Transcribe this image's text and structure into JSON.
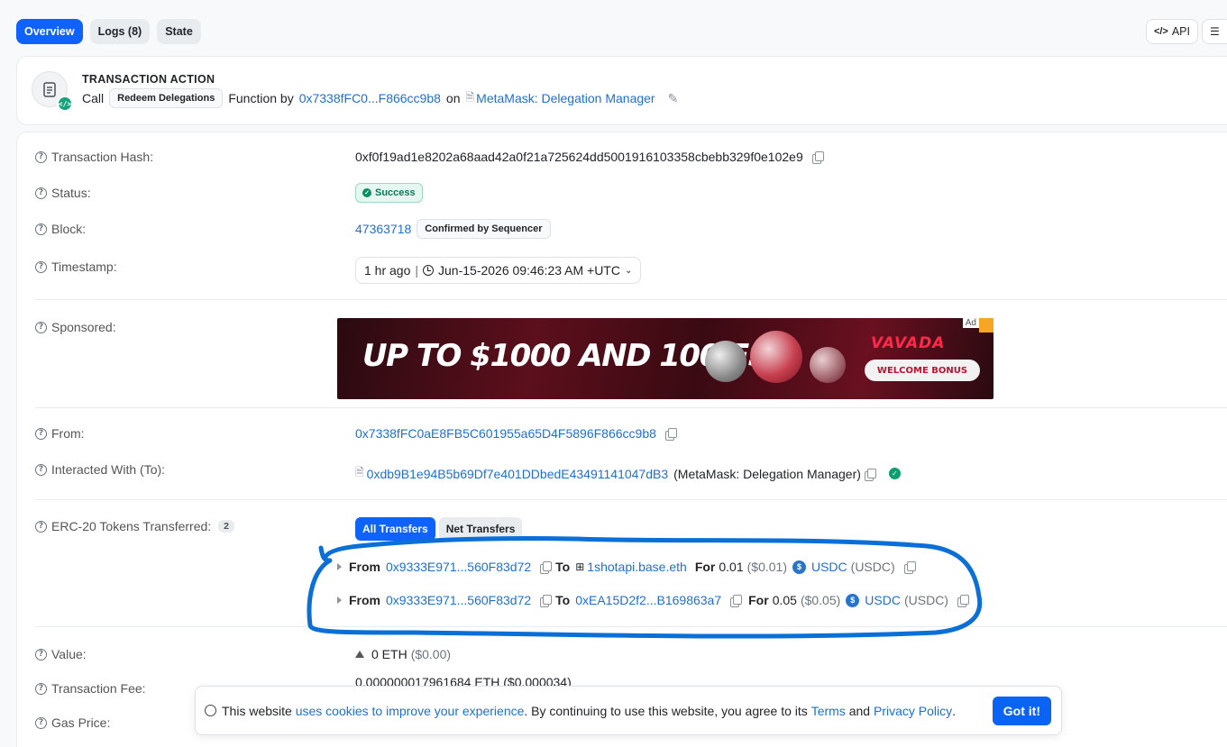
{
  "tabs": [
    "Overview",
    "Logs (8)",
    "State"
  ],
  "top_right": {
    "api": "API"
  },
  "action": {
    "title": "TRANSACTION ACTION",
    "call": "Call",
    "method": "Redeem Delegations",
    "function_by": "Function by",
    "caller": "0x7338fFC0...F866cc9b8",
    "on": "on",
    "contract": "MetaMask: Delegation Manager"
  },
  "fields": {
    "tx_hash": {
      "label": "Transaction Hash:",
      "value": "0xf0f19ad1e8202a68aad42a0f21a725624dd5001916103358cbebb329f0e102e9"
    },
    "status": {
      "label": "Status:",
      "value": "Success"
    },
    "block": {
      "label": "Block:",
      "value": "47363718",
      "tag": "Confirmed by Sequencer"
    },
    "timestamp": {
      "label": "Timestamp:",
      "ago": "1 hr ago",
      "value": "Jun-15-2026 09:46:23 AM +UTC"
    },
    "sponsored": {
      "label": "Sponsored:"
    },
    "from": {
      "label": "From:",
      "value": "0x7338fFC0aE8FB5C601955a65D4F5896F866cc9b8"
    },
    "to": {
      "label": "Interacted With (To):",
      "value": "0xdb9B1e94B5b69Df7e401DDbedE43491141047dB3",
      "name": "(MetaMask: Delegation Manager)"
    },
    "erc20": {
      "label": "ERC-20 Tokens Transferred:",
      "count": "2",
      "all": "All Transfers",
      "net": "Net Transfers"
    },
    "value": {
      "label": "Value:",
      "amount": "0 ETH",
      "usd": "($0.00)"
    },
    "fee": {
      "label": "Transaction Fee:",
      "value": "0.000000017961684 ETH ($0.000034)"
    },
    "gas": {
      "label": "Gas Price:"
    }
  },
  "transfers": [
    {
      "from_label": "From",
      "from": "0x9333E971...560F83d72",
      "to_label": "To",
      "to": "1shotapi.base.eth",
      "for_label": "For",
      "amount": "0.01",
      "usd": "($0.01)",
      "token": "USDC",
      "symbol": "(USDC)"
    },
    {
      "from_label": "From",
      "from": "0x9333E971...560F83d72",
      "to_label": "To",
      "to": "0xEA15D2f2...B169863a7",
      "for_label": "For",
      "amount": "0.05",
      "usd": "($0.05)",
      "token": "USDC",
      "symbol": "(USDC)"
    }
  ],
  "ad": {
    "headline": "UP TO $1000 AND 100 FS",
    "brand": "VAVADA",
    "button": "WELCOME BONUS",
    "tag": "Ad"
  },
  "cookie": {
    "pre": "This website",
    "link1": "uses cookies to improve your experience",
    "mid": ". By continuing to use this website, you agree to its",
    "terms": "Terms",
    "and": "and",
    "privacy": "Privacy Policy",
    "end": ".",
    "button": "Got it!"
  },
  "colors": {
    "primary": "#0f62fe",
    "link": "#1f6fd1",
    "success": "#0a8f63",
    "annotation": "#0a6fd6"
  }
}
